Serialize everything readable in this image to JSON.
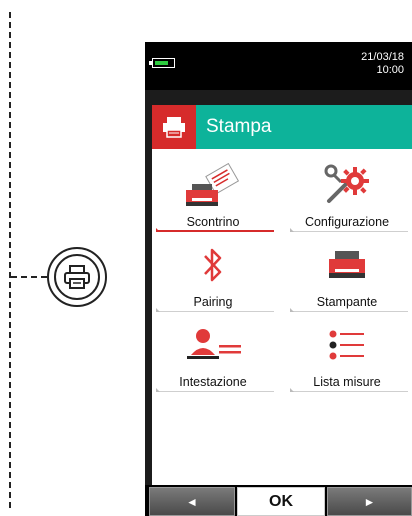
{
  "callout": {
    "icon": "printer-icon"
  },
  "status": {
    "battery_level": 0.8,
    "date": "21/03/18",
    "time": "10:00"
  },
  "header": {
    "title": "Stampa",
    "icon": "printer-icon",
    "title_bg": "#0db39a",
    "icon_bg": "#d62b2b"
  },
  "menu": {
    "items": [
      {
        "label": "Scontrino",
        "icon": "receipt-printer-icon",
        "selected": true
      },
      {
        "label": "Configurazione",
        "icon": "settings-gear-wrench-icon",
        "selected": false
      },
      {
        "label": "Pairing",
        "icon": "bluetooth-icon",
        "selected": false
      },
      {
        "label": "Stampante",
        "icon": "printer-icon",
        "selected": false
      },
      {
        "label": "Intestazione",
        "icon": "header-person-icon",
        "selected": false
      },
      {
        "label": "Lista misure",
        "icon": "list-icon",
        "selected": false
      }
    ]
  },
  "footer": {
    "left": "◄",
    "ok": "OK",
    "right": "►"
  }
}
